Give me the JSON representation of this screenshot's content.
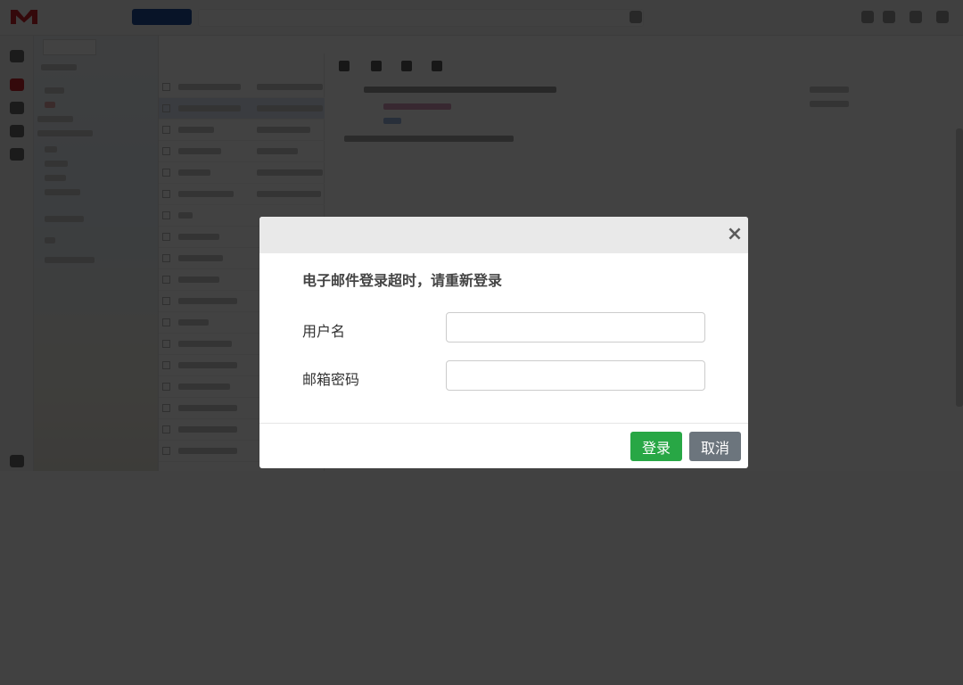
{
  "modal": {
    "close_glyph": "×",
    "title": "电子邮件登录超时，请重新登录",
    "username_label": "用户名",
    "username_value": "",
    "password_label": "邮箱密码",
    "password_value": "",
    "login_label": "登录",
    "cancel_label": "取消"
  },
  "colors": {
    "login_button": "#28a745",
    "cancel_button": "#6c757d",
    "overlay": "#414141",
    "header": "#e9e9e9"
  },
  "icons": [
    "close-icon"
  ]
}
